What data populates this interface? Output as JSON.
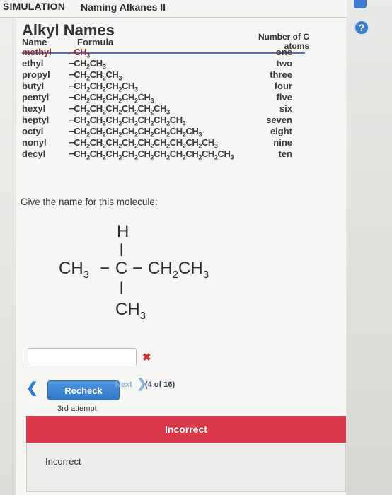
{
  "header": {
    "tag": "SIMULATION",
    "title": "Naming Alkanes II"
  },
  "help": {
    "label": "?"
  },
  "table": {
    "title": "Alkyl Names",
    "col_name": "Name",
    "col_formula": "Formula",
    "col_count": "Number of C atoms",
    "rows": [
      {
        "name": "methyl",
        "count": "one"
      },
      {
        "name": "ethyl",
        "count": "two"
      },
      {
        "name": "propyl",
        "count": "three"
      },
      {
        "name": "butyl",
        "count": "four"
      },
      {
        "name": "pentyl",
        "count": "five"
      },
      {
        "name": "hexyl",
        "count": "six"
      },
      {
        "name": "heptyl",
        "count": "seven"
      },
      {
        "name": "octyl",
        "count": "eight"
      },
      {
        "name": "nonyl",
        "count": "nine"
      },
      {
        "name": "decyl",
        "count": "ten"
      }
    ]
  },
  "question": "Give the name for this molecule:",
  "molecule": {
    "top": "H",
    "left": "CH",
    "left_sub": "3",
    "center": "C",
    "right": "CH",
    "right_sub1": "2",
    "right_mid": "CH",
    "right_sub2": "3",
    "bottom": "CH",
    "bottom_sub": "3"
  },
  "answer": {
    "value": "",
    "status_icon": "x-mark-icon"
  },
  "nav": {
    "recheck_label": "Recheck",
    "next_label": "Next",
    "progress": "(4 of 16)",
    "attempt": "3rd attempt"
  },
  "feedback": {
    "banner": "Incorrect",
    "text": "Incorrect"
  },
  "colors": {
    "accent": "#3277c4",
    "error": "#d8384a"
  }
}
